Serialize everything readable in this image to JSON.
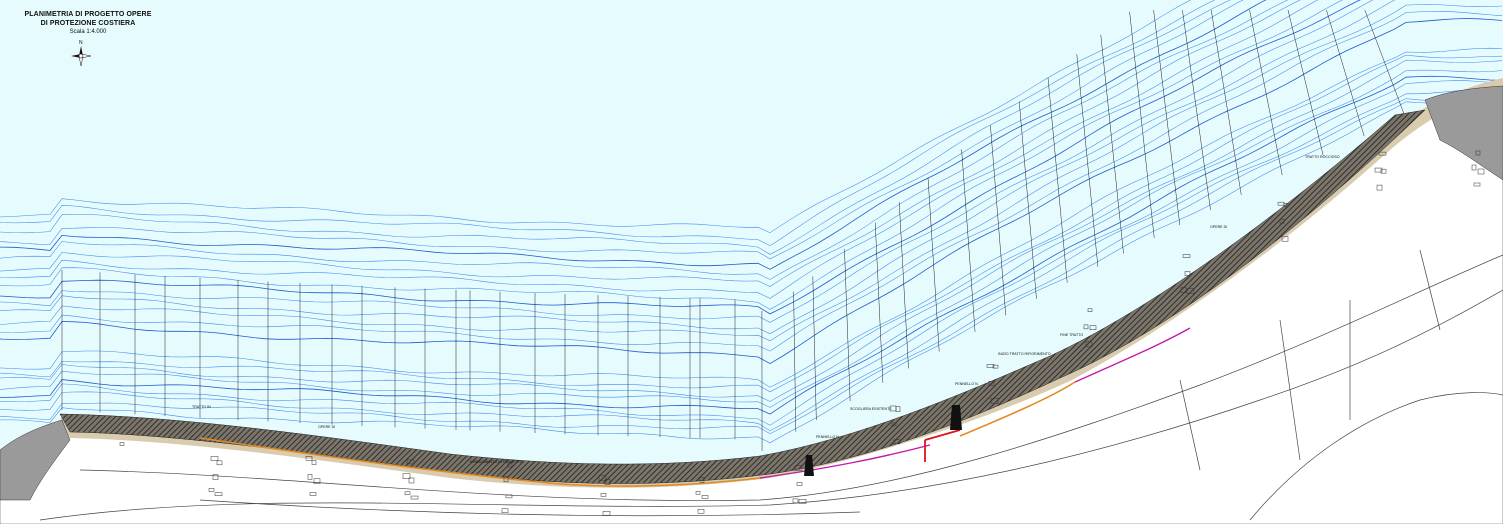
{
  "title": {
    "line1": "PLANIMETRIA DI PROGETTO OPERE",
    "line2": "DI PROTEZIONE COSTIERA",
    "scale": "Scala 1:4.000"
  },
  "north_arrow": {
    "letter": "N",
    "icon": "compass-rose-icon"
  },
  "colors": {
    "sea": "#e6fbfd",
    "bathymetry_line": "#2f78e8",
    "section_line": "#222222",
    "beach": "#d8cbae",
    "rock_hatch": "#2a2a2a",
    "orange_edge": "#e28a26",
    "magenta_edge": "#c21aa8",
    "red_outline": "#e3121b",
    "land": "#ffffff"
  },
  "map_labels": [
    "TRATTO IN",
    "OPERE DI",
    "PENNELLO N.",
    "SCOGLIERA ESISTENTE",
    "INIZIO TRATTO RIFIORIMENTO",
    "RIPASCIMENTO DI PROGETTO",
    "FINE TRATTO",
    "TRATTO ROCCIOSO"
  ]
}
